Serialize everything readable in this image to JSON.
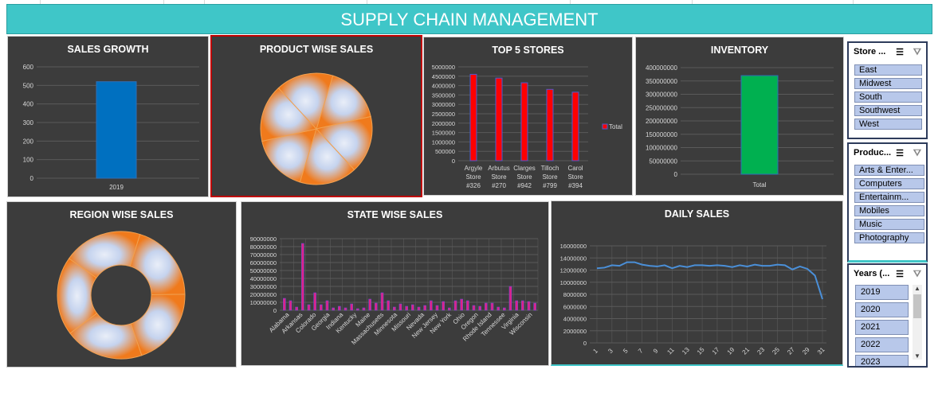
{
  "title": "SUPPLY CHAIN MANAGEMENT",
  "panels": {
    "sales_growth": "SALES GROWTH",
    "product_wise": "PRODUCT WISE SALES",
    "top5": "TOP 5 STORES",
    "inventory": "INVENTORY",
    "region_wise": "REGION WISE SALES",
    "state_wise": "STATE WISE SALES",
    "daily": "DAILY SALES"
  },
  "slicers": {
    "store": {
      "label": "Store ...",
      "items": [
        "East",
        "Midwest",
        "South",
        "Southwest",
        "West"
      ]
    },
    "product": {
      "label": "Produc...",
      "items": [
        "Arts & Enter...",
        "Computers",
        "Entertainm...",
        "Mobiles",
        "Music",
        "Photography"
      ]
    },
    "years": {
      "label": "Years (...",
      "items": [
        "2019",
        "2020",
        "2021",
        "2022",
        "2023"
      ]
    }
  },
  "icons": [
    "multi-select-icon",
    "clear-filter-icon",
    "scroll-up-icon",
    "scroll-down-icon"
  ],
  "colors": {
    "banner": "#3fc6c8",
    "panel": "#3c3c3c",
    "sales_bar": "#0070c0",
    "store_bar": "#ff0000",
    "inventory_bar": "#00b050",
    "line": "#4a8fd8",
    "state_bar": "#e0208a"
  },
  "chart_data": [
    {
      "id": "sales_growth",
      "type": "bar",
      "title": "SALES GROWTH",
      "categories": [
        "2019"
      ],
      "values": [
        520
      ],
      "ylim": [
        0,
        600
      ],
      "yticks": [
        "0",
        "100",
        "200",
        "300",
        "400",
        "500",
        "600"
      ],
      "grid": true
    },
    {
      "id": "product_wise",
      "type": "pie",
      "title": "PRODUCT WISE SALES",
      "values": [
        1,
        1,
        1,
        1,
        1,
        1
      ]
    },
    {
      "id": "top5",
      "type": "bar",
      "title": "TOP 5 STORES",
      "categories": [
        [
          "Argyle",
          "Store",
          "#326"
        ],
        [
          "Arbutus",
          "Store",
          "#270"
        ],
        [
          "Clarges",
          "Store",
          "#942"
        ],
        [
          "Tilloch",
          "Store",
          "#799"
        ],
        [
          "Carol",
          "Store",
          "#394"
        ]
      ],
      "series": [
        {
          "name": "Total",
          "values": [
            4600000,
            4400000,
            4150000,
            3800000,
            3650000
          ]
        }
      ],
      "ylim": [
        0,
        5000000
      ],
      "yticks": [
        "0",
        "500000",
        "1000000",
        "1500000",
        "2000000",
        "2500000",
        "3000000",
        "3500000",
        "4000000",
        "4500000",
        "5000000"
      ],
      "legend": "right"
    },
    {
      "id": "inventory",
      "type": "bar",
      "title": "INVENTORY",
      "categories": [
        "Total"
      ],
      "values": [
        370000000
      ],
      "ylim": [
        0,
        400000000
      ],
      "yticks": [
        "0",
        "50000000",
        "100000000",
        "150000000",
        "200000000",
        "250000000",
        "300000000",
        "350000000",
        "400000000"
      ]
    },
    {
      "id": "region_wise",
      "type": "pie",
      "title": "REGION WISE SALES",
      "values": [
        1,
        1,
        1,
        1,
        1
      ]
    },
    {
      "id": "state_wise",
      "type": "bar",
      "title": "STATE WISE SALES",
      "ylim": [
        0,
        90000000
      ],
      "yticks": [
        "0",
        "10000000",
        "20000000",
        "30000000",
        "40000000",
        "50000000",
        "60000000",
        "70000000",
        "80000000",
        "90000000"
      ],
      "xticklabels": [
        "Alabama",
        "Arkansas",
        "Colorado",
        "Georgia",
        "Indiana",
        "Kentucky",
        "Maine",
        "Massachusetts",
        "Minnesota",
        "Missouri",
        "Nevada",
        "New Jersey",
        "New York",
        "Ohio",
        "Oregon",
        "Rhode Island",
        "Tennessee",
        "Virginia",
        "Wisconsin"
      ],
      "values": [
        15,
        12,
        4,
        84,
        7,
        22,
        7,
        12,
        3,
        5,
        3,
        8,
        2,
        3,
        14,
        9,
        22,
        12,
        4,
        8,
        5,
        7,
        4,
        6,
        12,
        6,
        11,
        3,
        12,
        14,
        12,
        6,
        5,
        9,
        9,
        4,
        3,
        30,
        12,
        12,
        11,
        9
      ],
      "value_unit": "millions"
    },
    {
      "id": "daily",
      "type": "line",
      "title": "DAILY SALES",
      "x": [
        1,
        2,
        3,
        4,
        5,
        6,
        7,
        8,
        9,
        10,
        11,
        12,
        13,
        14,
        15,
        16,
        17,
        18,
        19,
        20,
        21,
        22,
        23,
        24,
        25,
        26,
        27,
        28,
        29,
        30,
        31
      ],
      "xticks": [
        "1",
        "3",
        "5",
        "7",
        "9",
        "11",
        "13",
        "15",
        "17",
        "19",
        "21",
        "23",
        "25",
        "27",
        "29",
        "31"
      ],
      "values": [
        12300000,
        12400000,
        12800000,
        12700000,
        13300000,
        13300000,
        12900000,
        12700000,
        12600000,
        12800000,
        12300000,
        12700000,
        12500000,
        12800000,
        12800000,
        12700000,
        12800000,
        12700000,
        12500000,
        12800000,
        12600000,
        12900000,
        12700000,
        12700000,
        12900000,
        12800000,
        12100000,
        12600000,
        12200000,
        11100000,
        7200000
      ],
      "ylim": [
        0,
        16000000
      ],
      "yticks": [
        "0",
        "2000000",
        "4000000",
        "6000000",
        "8000000",
        "10000000",
        "12000000",
        "14000000",
        "16000000"
      ]
    }
  ]
}
